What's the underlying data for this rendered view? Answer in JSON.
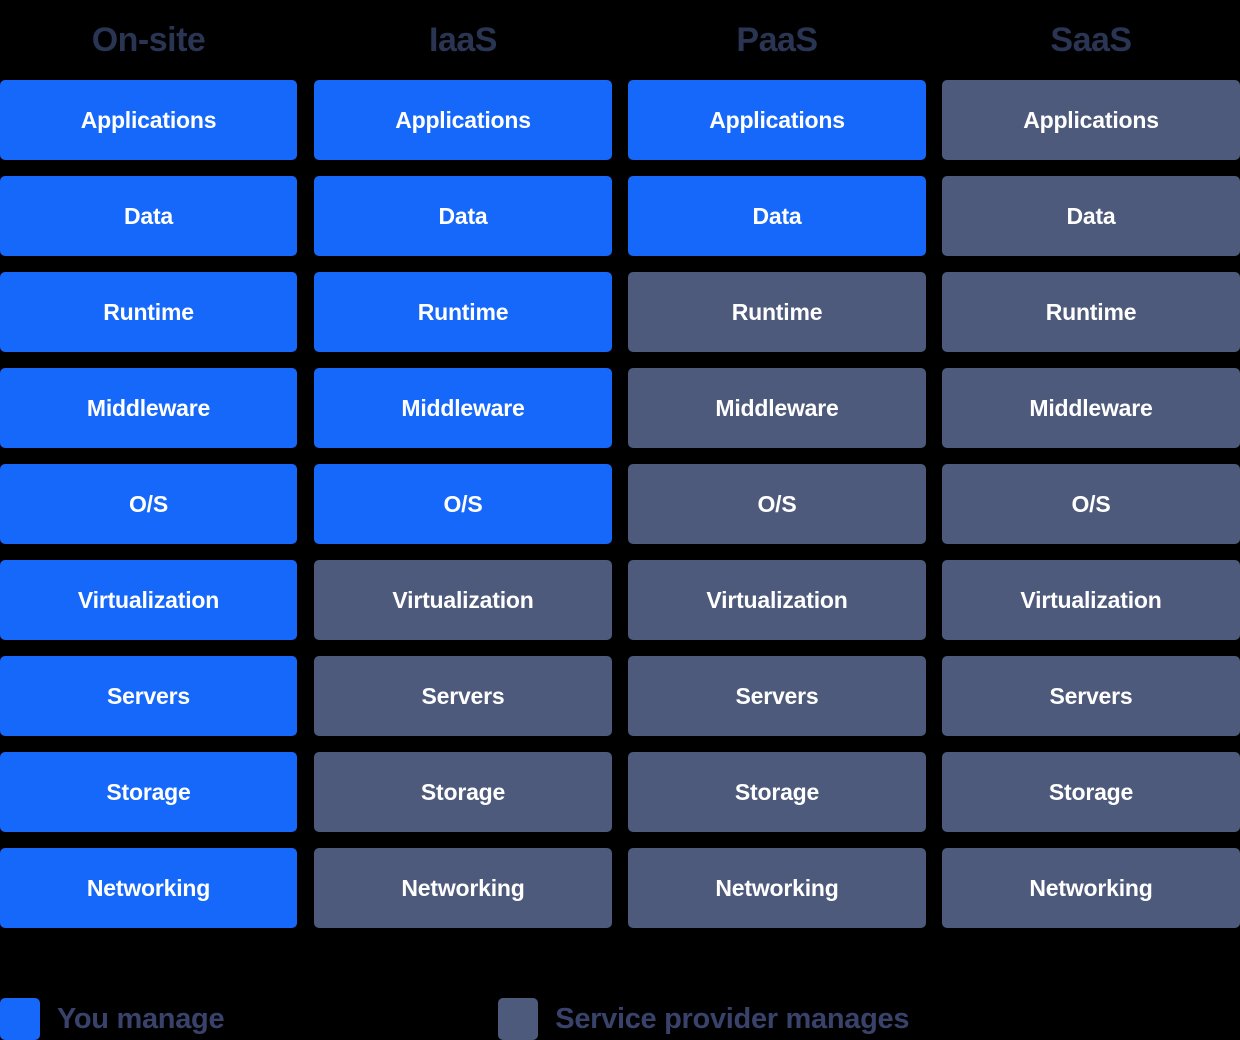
{
  "diagram": {
    "columns": [
      {
        "id": "on-site",
        "label": "On-site"
      },
      {
        "id": "iaas",
        "label": "IaaS"
      },
      {
        "id": "paas",
        "label": "PaaS"
      },
      {
        "id": "saas",
        "label": "SaaS"
      }
    ],
    "layers": [
      "Applications",
      "Data",
      "Runtime",
      "Middleware",
      "O/S",
      "Virtualization",
      "Servers",
      "Storage",
      "Networking"
    ],
    "rows": [
      {
        "layer": "Applications",
        "cells": [
          {
            "column": "On-site",
            "label": "Applications",
            "owner": "you"
          },
          {
            "column": "IaaS",
            "label": "Applications",
            "owner": "you"
          },
          {
            "column": "PaaS",
            "label": "Applications",
            "owner": "you"
          },
          {
            "column": "SaaS",
            "label": "Applications",
            "owner": "provider"
          }
        ]
      },
      {
        "layer": "Data",
        "cells": [
          {
            "column": "On-site",
            "label": "Data",
            "owner": "you"
          },
          {
            "column": "IaaS",
            "label": "Data",
            "owner": "you"
          },
          {
            "column": "PaaS",
            "label": "Data",
            "owner": "you"
          },
          {
            "column": "SaaS",
            "label": "Data",
            "owner": "provider"
          }
        ]
      },
      {
        "layer": "Runtime",
        "cells": [
          {
            "column": "On-site",
            "label": "Runtime",
            "owner": "you"
          },
          {
            "column": "IaaS",
            "label": "Runtime",
            "owner": "you"
          },
          {
            "column": "PaaS",
            "label": "Runtime",
            "owner": "provider"
          },
          {
            "column": "SaaS",
            "label": "Runtime",
            "owner": "provider"
          }
        ]
      },
      {
        "layer": "Middleware",
        "cells": [
          {
            "column": "On-site",
            "label": "Middleware",
            "owner": "you"
          },
          {
            "column": "IaaS",
            "label": "Middleware",
            "owner": "you"
          },
          {
            "column": "PaaS",
            "label": "Middleware",
            "owner": "provider"
          },
          {
            "column": "SaaS",
            "label": "Middleware",
            "owner": "provider"
          }
        ]
      },
      {
        "layer": "O/S",
        "cells": [
          {
            "column": "On-site",
            "label": "O/S",
            "owner": "you"
          },
          {
            "column": "IaaS",
            "label": "O/S",
            "owner": "you"
          },
          {
            "column": "PaaS",
            "label": "O/S",
            "owner": "provider"
          },
          {
            "column": "SaaS",
            "label": "O/S",
            "owner": "provider"
          }
        ]
      },
      {
        "layer": "Virtualization",
        "cells": [
          {
            "column": "On-site",
            "label": "Virtualization",
            "owner": "you"
          },
          {
            "column": "IaaS",
            "label": "Virtualization",
            "owner": "provider"
          },
          {
            "column": "PaaS",
            "label": "Virtualization",
            "owner": "provider"
          },
          {
            "column": "SaaS",
            "label": "Virtualization",
            "owner": "provider"
          }
        ]
      },
      {
        "layer": "Servers",
        "cells": [
          {
            "column": "On-site",
            "label": "Servers",
            "owner": "you"
          },
          {
            "column": "IaaS",
            "label": "Servers",
            "owner": "provider"
          },
          {
            "column": "PaaS",
            "label": "Servers",
            "owner": "provider"
          },
          {
            "column": "SaaS",
            "label": "Servers",
            "owner": "provider"
          }
        ]
      },
      {
        "layer": "Storage",
        "cells": [
          {
            "column": "On-site",
            "label": "Storage",
            "owner": "you"
          },
          {
            "column": "IaaS",
            "label": "Storage",
            "owner": "provider"
          },
          {
            "column": "PaaS",
            "label": "Storage",
            "owner": "provider"
          },
          {
            "column": "SaaS",
            "label": "Storage",
            "owner": "provider"
          }
        ]
      },
      {
        "layer": "Networking",
        "cells": [
          {
            "column": "On-site",
            "label": "Networking",
            "owner": "you"
          },
          {
            "column": "IaaS",
            "label": "Networking",
            "owner": "provider"
          },
          {
            "column": "PaaS",
            "label": "Networking",
            "owner": "provider"
          },
          {
            "column": "SaaS",
            "label": "Networking",
            "owner": "provider"
          }
        ]
      }
    ]
  },
  "legend": {
    "items": [
      {
        "key": "you",
        "label": "You manage",
        "color": "#1668fb"
      },
      {
        "key": "provider",
        "label": "Service provider manages",
        "color": "#4e5a7b"
      }
    ]
  },
  "colors": {
    "background": "#000000",
    "you_manage": "#1668fb",
    "provider_manages": "#4e5a7b",
    "header_text": "#2a3453",
    "legend_text": "#39426a",
    "cell_text": "#ffffff"
  }
}
